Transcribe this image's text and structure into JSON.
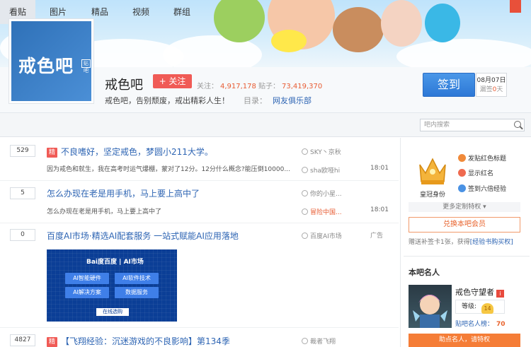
{
  "header": {
    "forum_name": "戒色吧",
    "logo_text": "戒色吧",
    "logo_badge": "贴吧",
    "follow_label": "+ 关注",
    "follow_count_label": "关注：",
    "follow_count": "4,917,178",
    "post_count_label": "贴子：",
    "post_count": "73,419,370",
    "slogan": "戒色吧，告别颓废，戒出精彩人生！",
    "catalog_label": "目录：",
    "catalog_value": "网友俱乐部",
    "sign_label": "签到",
    "sign_date": "08月07日",
    "sign_missed_prefix": "漏签",
    "sign_missed_days": "0",
    "sign_missed_suffix": "天"
  },
  "nav": {
    "tabs": [
      {
        "label": "看贴"
      },
      {
        "label": "图片"
      },
      {
        "label": "精品"
      },
      {
        "label": "视频"
      },
      {
        "label": "群组"
      }
    ],
    "search_placeholder": "吧内搜索"
  },
  "threads": [
    {
      "replies": "529",
      "tag": "精",
      "title": "不良嗜好，坚定戒色，梦圆小211大学。",
      "summary": "因为戒色和就生，我在高考时运气爆棚，蒙对了12分。12分什么概念?能压倒10000...",
      "author": "SKY丶京秋",
      "last_author": "sha欧哑hi",
      "time": "18:01"
    },
    {
      "replies": "5",
      "title": "怎么办现在老是用手机，马上要上高中了",
      "summary": "怎么办现在老是用手机，马上要上高中了",
      "author": "你的小星...",
      "last_author": "冒险中国...",
      "time": "18:01"
    },
    {
      "replies": "0",
      "title": "百度AI市场·精选AI配套服务 一站式赋能AI应用落地",
      "author": "百度AI市场",
      "ad_label": "广告",
      "ad": {
        "brand": "Bai度百度 | AI市场",
        "cells": [
          "AI智能硬件",
          "AI软件技术",
          "AI解决方案",
          "数据服务"
        ],
        "link": "在线选购"
      }
    },
    {
      "replies": "4827",
      "tag": "精",
      "title": "【飞翔经验：沉迷游戏的不良影响】第134季",
      "author": "裁者飞翔"
    }
  ],
  "sidebar": {
    "crown_label": "皇冠身份",
    "perks": [
      {
        "label": "发贴红色标题",
        "icon": "title-icon"
      },
      {
        "label": "显示红名",
        "icon": "redname-icon"
      },
      {
        "label": "签到六倍经验",
        "icon": "sign-icon"
      }
    ],
    "more_label": "更多定制特权",
    "exchange_label": "兑换本吧会员",
    "gift_prefix": "赠送补签卡1张，获得",
    "gift_link": "[经验书购买权]",
    "famous_title": "本吧名人",
    "famous_name": "戒色守望者",
    "famous_badge": "i",
    "level_label": "等级:",
    "level_value": "14",
    "rank_label": "贴吧名人榜：",
    "rank_value": "70",
    "help_label": "助点名人，请特权"
  },
  "colors": {
    "accent": "#2d78d6",
    "follow": "#f05b56",
    "link": "#2d64b3",
    "highlight": "#e8632d"
  }
}
